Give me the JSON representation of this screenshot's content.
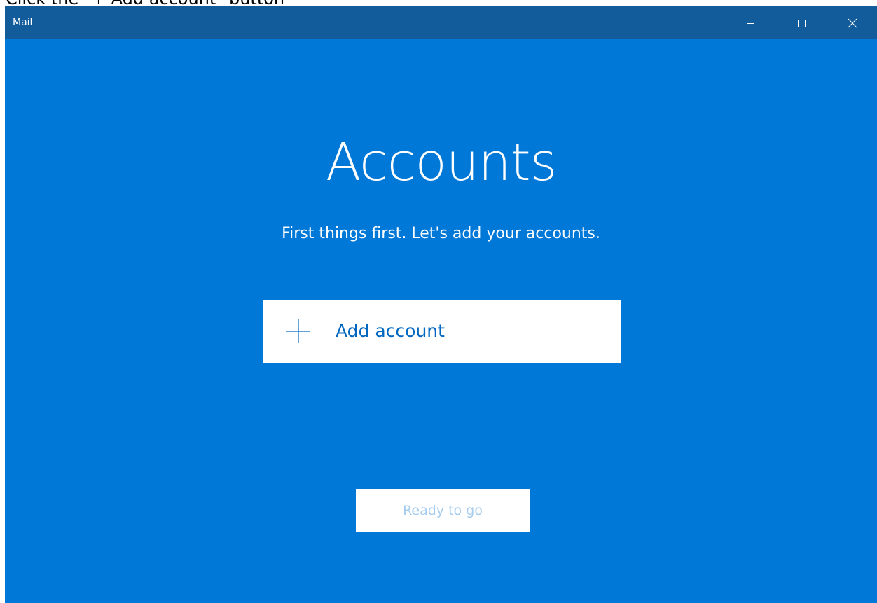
{
  "instruction": {
    "text": "Click the \"+ Add account\" button"
  },
  "window": {
    "title": "Mail",
    "controls": {
      "minimize": "minimize-icon",
      "maximize": "maximize-icon",
      "close": "close-icon"
    }
  },
  "main": {
    "heading": "Accounts",
    "subheading": "First things first. Let's add your accounts.",
    "add_account": {
      "icon": "plus-icon",
      "label": "Add account"
    },
    "ready_button": {
      "label": "Ready to go",
      "state": "disabled"
    }
  },
  "colors": {
    "background": "#0078d7",
    "titlebar": "#125c9c",
    "accent_text": "#0067c0",
    "disabled_text": "#a6cdee",
    "white": "#ffffff"
  }
}
